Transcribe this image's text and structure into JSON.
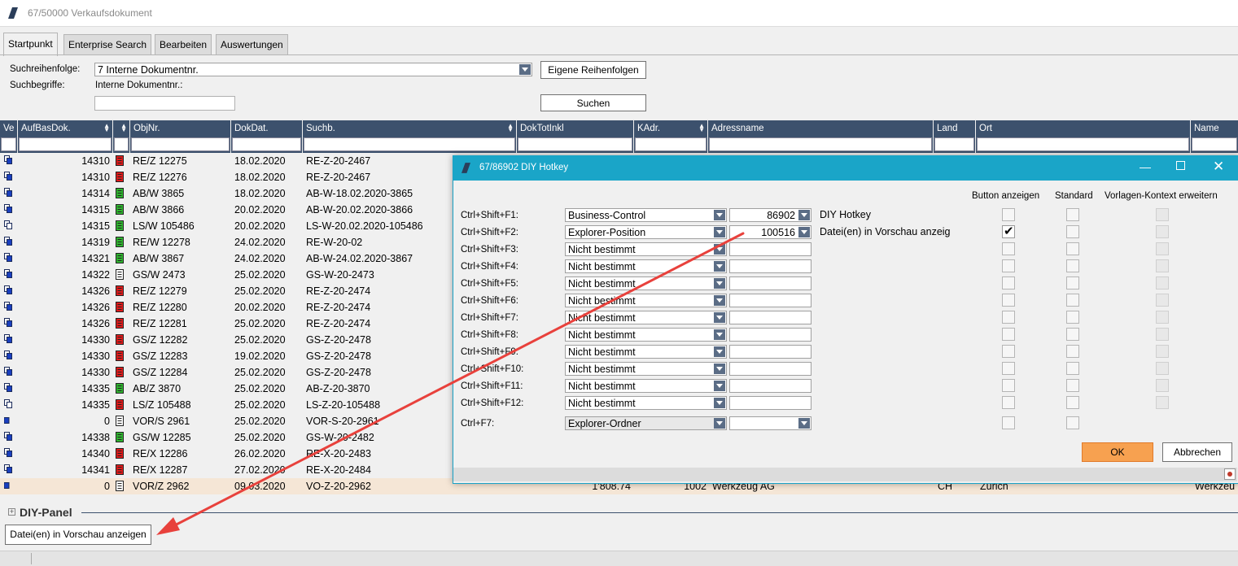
{
  "window": {
    "title": "67/50000 Verkaufsdokument"
  },
  "tabs": [
    "Startpunkt",
    "Enterprise Search",
    "Bearbeiten",
    "Auswertungen"
  ],
  "search": {
    "order_label": "Suchreihenfolge:",
    "order_value": "7 Interne Dokumentnr.",
    "terms_label": "Suchbegriffe:",
    "field_label": "Interne Dokumentnr.:",
    "own_orders_button": "Eigene Reihenfolgen",
    "search_button": "Suchen"
  },
  "grid": {
    "columns": [
      "Ve",
      "AufBasDok.",
      "",
      "ObjNr.",
      "DokDat.",
      "Suchb.",
      "DokTotInkl",
      "KAdr.",
      "Adressname",
      "Land",
      "Ort",
      "Name"
    ],
    "rows": [
      {
        "ve": "multi-blue",
        "auf": "14310",
        "color": "red",
        "obj": "RE/Z 12275",
        "dat": "18.02.2020",
        "such": "RE-Z-20-2467"
      },
      {
        "ve": "multi-blue",
        "auf": "14310",
        "color": "red",
        "obj": "RE/Z 12276",
        "dat": "18.02.2020",
        "such": "RE-Z-20-2467"
      },
      {
        "ve": "multi-blue",
        "auf": "14314",
        "color": "green",
        "obj": "AB/W 3865",
        "dat": "18.02.2020",
        "such": "AB-W-18.02.2020-3865"
      },
      {
        "ve": "multi-blue",
        "auf": "14315",
        "color": "green",
        "obj": "AB/W 3866",
        "dat": "20.02.2020",
        "such": "AB-W-20.02.2020-3866"
      },
      {
        "ve": "multi-white",
        "auf": "14315",
        "color": "green",
        "obj": "LS/W 105486",
        "dat": "20.02.2020",
        "such": "LS-W-20.02.2020-105486"
      },
      {
        "ve": "multi-blue",
        "auf": "14319",
        "color": "green",
        "obj": "RE/W 12278",
        "dat": "24.02.2020",
        "such": "RE-W-20-02"
      },
      {
        "ve": "multi-blue",
        "auf": "14321",
        "color": "green",
        "obj": "AB/W 3867",
        "dat": "24.02.2020",
        "such": "AB-W-24.02.2020-3867"
      },
      {
        "ve": "multi-blue",
        "auf": "14322",
        "color": "white",
        "obj": "GS/W 2473",
        "dat": "25.02.2020",
        "such": "GS-W-20-2473"
      },
      {
        "ve": "multi-blue",
        "auf": "14326",
        "color": "red",
        "obj": "RE/Z 12279",
        "dat": "25.02.2020",
        "such": "RE-Z-20-2474"
      },
      {
        "ve": "multi-blue",
        "auf": "14326",
        "color": "red",
        "obj": "RE/Z 12280",
        "dat": "20.02.2020",
        "such": "RE-Z-20-2474"
      },
      {
        "ve": "multi-blue",
        "auf": "14326",
        "color": "red",
        "obj": "RE/Z 12281",
        "dat": "25.02.2020",
        "such": "RE-Z-20-2474"
      },
      {
        "ve": "multi-blue",
        "auf": "14330",
        "color": "red",
        "obj": "GS/Z 12282",
        "dat": "25.02.2020",
        "such": "GS-Z-20-2478"
      },
      {
        "ve": "multi-blue",
        "auf": "14330",
        "color": "red",
        "obj": "GS/Z 12283",
        "dat": "19.02.2020",
        "such": "GS-Z-20-2478"
      },
      {
        "ve": "multi-blue",
        "auf": "14330",
        "color": "red",
        "obj": "GS/Z 12284",
        "dat": "25.02.2020",
        "such": "GS-Z-20-2478"
      },
      {
        "ve": "multi-blue",
        "auf": "14335",
        "color": "green",
        "obj": "AB/Z 3870",
        "dat": "25.02.2020",
        "such": "AB-Z-20-3870"
      },
      {
        "ve": "multi-white",
        "auf": "14335",
        "color": "red",
        "obj": "LS/Z 105488",
        "dat": "25.02.2020",
        "such": "LS-Z-20-105488"
      },
      {
        "ve": "single-blue",
        "auf": "0",
        "color": "white",
        "obj": "VOR/S 2961",
        "dat": "25.02.2020",
        "such": "VOR-S-20-2961"
      },
      {
        "ve": "multi-blue",
        "auf": "14338",
        "color": "green",
        "obj": "GS/W 12285",
        "dat": "25.02.2020",
        "such": "GS-W-20-2482"
      },
      {
        "ve": "multi-blue",
        "auf": "14340",
        "color": "red",
        "obj": "RE/X 12286",
        "dat": "26.02.2020",
        "such": "RE-X-20-2483"
      },
      {
        "ve": "multi-blue",
        "auf": "14341",
        "color": "red",
        "obj": "RE/X 12287",
        "dat": "27.02.2020",
        "such": "RE-X-20-2484"
      },
      {
        "ve": "single-blue",
        "auf": "0",
        "color": "white",
        "obj": "VOR/Z 2962",
        "dat": "09.03.2020",
        "such": "VO-Z-20-2962",
        "tot": "1'808.74",
        "kadr": "1002",
        "adr": "Werkzeug AG",
        "land": "CH",
        "ort": "Zürich",
        "name": "Werkzeu",
        "selected": true
      }
    ]
  },
  "panel": {
    "title": "DIY-Panel",
    "button": "Datei(en) in Vorschau anzeigen"
  },
  "dialog": {
    "title": "67/86902 DIY Hotkey",
    "col_headers": [
      "Button anzeigen",
      "Standard",
      "Vorlagen-Kontext erweitern"
    ],
    "rows": [
      {
        "key": "Ctrl+Shift+F1:",
        "action": "Business-Control",
        "value": "86902",
        "desc": "DIY Hotkey",
        "show": false
      },
      {
        "key": "Ctrl+Shift+F2:",
        "action": "Explorer-Position",
        "value": "100516",
        "desc": "Datei(en) in Vorschau anzeig",
        "show": true
      },
      {
        "key": "Ctrl+Shift+F3:",
        "action": "Nicht bestimmt",
        "value": "",
        "desc": "",
        "show": false
      },
      {
        "key": "Ctrl+Shift+F4:",
        "action": "Nicht bestimmt",
        "value": "",
        "desc": "",
        "show": false
      },
      {
        "key": "Ctrl+Shift+F5:",
        "action": "Nicht bestimmt",
        "value": "",
        "desc": "",
        "show": false
      },
      {
        "key": "Ctrl+Shift+F6:",
        "action": "Nicht bestimmt",
        "value": "",
        "desc": "",
        "show": false
      },
      {
        "key": "Ctrl+Shift+F7:",
        "action": "Nicht bestimmt",
        "value": "",
        "desc": "",
        "show": false
      },
      {
        "key": "Ctrl+Shift+F8:",
        "action": "Nicht bestimmt",
        "value": "",
        "desc": "",
        "show": false
      },
      {
        "key": "Ctrl+Shift+F9:",
        "action": "Nicht bestimmt",
        "value": "",
        "desc": "",
        "show": false
      },
      {
        "key": "Ctrl+Shift+F10:",
        "action": "Nicht bestimmt",
        "value": "",
        "desc": "",
        "show": false
      },
      {
        "key": "Ctrl+Shift+F11:",
        "action": "Nicht bestimmt",
        "value": "",
        "desc": "",
        "show": false
      },
      {
        "key": "Ctrl+Shift+F12:",
        "action": "Nicht bestimmt",
        "value": "",
        "desc": "",
        "show": false
      }
    ],
    "extra_row": {
      "key": "Ctrl+F7:",
      "action": "Explorer-Ordner",
      "value": ""
    },
    "ok": "OK",
    "cancel": "Abbrechen"
  },
  "colors": {
    "header_bg": "#3c516d",
    "dialog_title": "#1aa5c8",
    "ok_button": "#f7a150",
    "selected_row": "#f5e6d6",
    "arrow": "#e8413c"
  }
}
